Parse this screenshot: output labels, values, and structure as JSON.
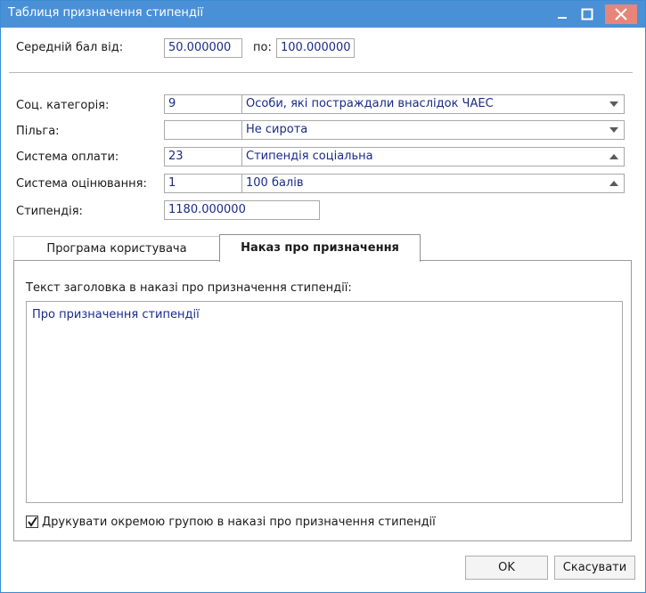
{
  "window": {
    "title": "Таблиця призначення стипендії"
  },
  "avg_grade": {
    "from_label": "Середній бал від:",
    "from_value": "50.000000",
    "to_label": "по:",
    "to_value": "100.000000"
  },
  "form": {
    "soc_category": {
      "label": "Соц. категорія:",
      "code": "9",
      "value": "Особи, які постраждали внаслідок ЧАЕС"
    },
    "benefit": {
      "label": "Пільга:",
      "code": "",
      "value": "Не сирота"
    },
    "payment_system": {
      "label": "Система оплати:",
      "code": "23",
      "value": "Стипендія соціальна"
    },
    "grading_system": {
      "label": "Система оцінювання:",
      "code": "1",
      "value": "100 балів"
    },
    "scholarship": {
      "label": "Стипендія:",
      "value": "1180.000000"
    }
  },
  "tabs": [
    {
      "label": "Програма користувача",
      "active": false
    },
    {
      "label": "Наказ про призначення",
      "active": true
    }
  ],
  "order_tab": {
    "header_label": "Текст заголовка в наказі про призначення стипендії:",
    "header_text": "Про призначення стипендії",
    "checkbox_label": "Друкувати окремою групою в наказі про призначення стипендії",
    "checkbox_checked": true
  },
  "buttons": {
    "ok": "OK",
    "cancel": "Скасувати"
  },
  "colors": {
    "titlebar": "#4a90d6",
    "close_button": "#e7857a",
    "field_text": "#1a2a8a"
  }
}
